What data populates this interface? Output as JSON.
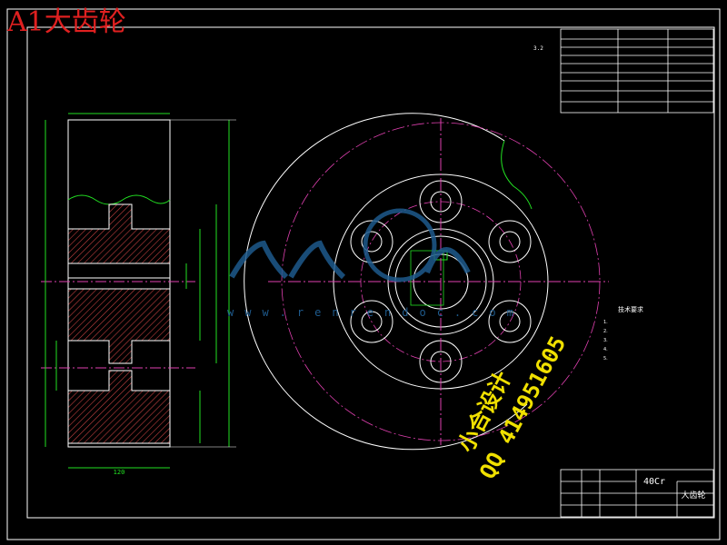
{
  "page_title": "A1大齿轮",
  "watermark": {
    "logo_text": "人人文库",
    "url_text": "www.renrendoc.com",
    "contact_line1": "小合设计",
    "contact_line2": "QQ 414951605"
  },
  "material": "40Cr",
  "part_name": "大齿轮",
  "roughness_symbol": "3.2",
  "tech_requirements_title": "技术要求",
  "tech_requirements": [
    "1.",
    "2.",
    "3.",
    "4.",
    "5."
  ],
  "parameter_table": {
    "rows": [
      [
        "",
        "",
        ""
      ],
      [
        "",
        "",
        ""
      ],
      [
        "",
        "",
        ""
      ],
      [
        "",
        "",
        ""
      ],
      [
        "",
        "",
        ""
      ],
      [
        "",
        "",
        ""
      ],
      [
        "",
        "",
        ""
      ],
      [
        "",
        "",
        ""
      ]
    ]
  },
  "title_block": {
    "scale_label": "",
    "sheet_label": ""
  },
  "dimensions": {
    "width_bottom": "120",
    "outer_diameter_label": "",
    "bore_label": ""
  },
  "colors": {
    "background": "#000000",
    "outline": "#ffffff",
    "dimension": "#22e022",
    "centerline": "#e040b0",
    "hatch": "#c04040",
    "title_red": "#e02020",
    "watermark_yellow": "#f0e000",
    "watermark_blue": "#1e5a8c"
  }
}
